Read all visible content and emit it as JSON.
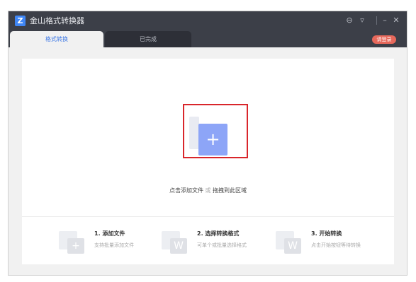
{
  "window": {
    "logo_glyph": "Z",
    "title": "金山格式转换器",
    "controls": {
      "feedback_glyph": "⊖",
      "menu_glyph": "▿",
      "minimize_glyph": "–",
      "close_glyph": "✕"
    },
    "login_label": "请登录"
  },
  "tabs": [
    {
      "label": "格式转换",
      "active": true
    },
    {
      "label": "已完成",
      "active": false
    }
  ],
  "drop_area": {
    "add_glyph": "+",
    "hint_main": "点击添加文件",
    "hint_or": "或",
    "hint_drag": "拖拽到此区域"
  },
  "steps": [
    {
      "title": "1. 添加文件",
      "subtitle": "支持批量添加文件",
      "icon_glyph": "+"
    },
    {
      "title": "2. 选择转换格式",
      "subtitle": "可单个或批量选择格式",
      "icon_glyph": "W"
    },
    {
      "title": "3. 开始转换",
      "subtitle": "点击开始按钮等待转换",
      "icon_glyph": "W"
    }
  ],
  "colors": {
    "titlebar": "#3c3f48",
    "accent": "#3d78e6",
    "login": "#e7685b",
    "add_button": "#8da5f7",
    "highlight": "#d9262b"
  }
}
